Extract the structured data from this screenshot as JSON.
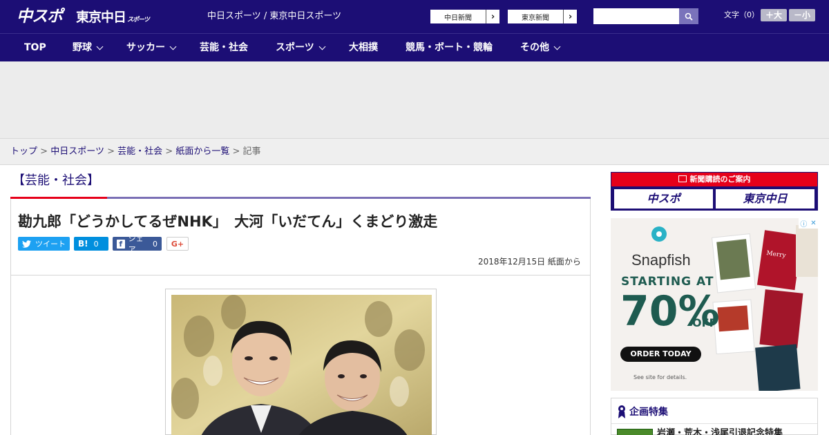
{
  "header": {
    "logo_main": "中スポ",
    "logo_tokyo": "東京中日",
    "logo_tokyo_sub": "スポーツ",
    "site_title": "中日スポーツ / 東京中日スポーツ",
    "ext_links": [
      {
        "label": "中日新聞"
      },
      {
        "label": "東京新聞"
      }
    ],
    "search": {
      "placeholder": "",
      "value": ""
    },
    "font_size": {
      "label": "文字（0）",
      "bigger": "＋大",
      "smaller": "－小"
    }
  },
  "nav": {
    "items": [
      {
        "label": "TOP",
        "has_menu": false
      },
      {
        "label": "野球",
        "has_menu": true
      },
      {
        "label": "サッカー",
        "has_menu": true
      },
      {
        "label": "芸能・社会",
        "has_menu": false
      },
      {
        "label": "スポーツ",
        "has_menu": true
      },
      {
        "label": "大相撲",
        "has_menu": false
      },
      {
        "label": "競馬・ボート・競輪",
        "has_menu": false
      },
      {
        "label": "その他",
        "has_menu": true
      }
    ]
  },
  "breadcrumb": {
    "items": [
      "トップ",
      "中日スポーツ",
      "芸能・社会",
      "紙面から一覧"
    ],
    "current": "記事",
    "separator": ">"
  },
  "article": {
    "category": "【芸能・社会】",
    "headline": "勘九郎「どうかしてるぜNHK」　大河「いだてん」くまどり激走",
    "share": {
      "tweet": "ツイート",
      "hatena_icon": "B!",
      "hatena_count": "0",
      "facebook": "シェア",
      "facebook_count": "0",
      "gplus": "G+"
    },
    "date": "2018年12月15日",
    "source": "紙面から"
  },
  "sidebar": {
    "subscription": {
      "header": "新聞購読のご案内",
      "logos": [
        "中スポ",
        "東京中日"
      ]
    },
    "ad": {
      "brand": "Snapfish",
      "starting": "STARTING AT",
      "percent": "70%",
      "off": "OFF",
      "cta": "ORDER TODAY",
      "note": "See site for details."
    },
    "feature": {
      "title": "企画特集",
      "item": "岩瀬・荒木・浅尾引退記念特集"
    }
  },
  "colors": {
    "brand_navy": "#1c0e75",
    "accent_red": "#e6001a",
    "twitter": "#1da1f2",
    "hatena": "#008fde",
    "facebook": "#3b5998"
  }
}
